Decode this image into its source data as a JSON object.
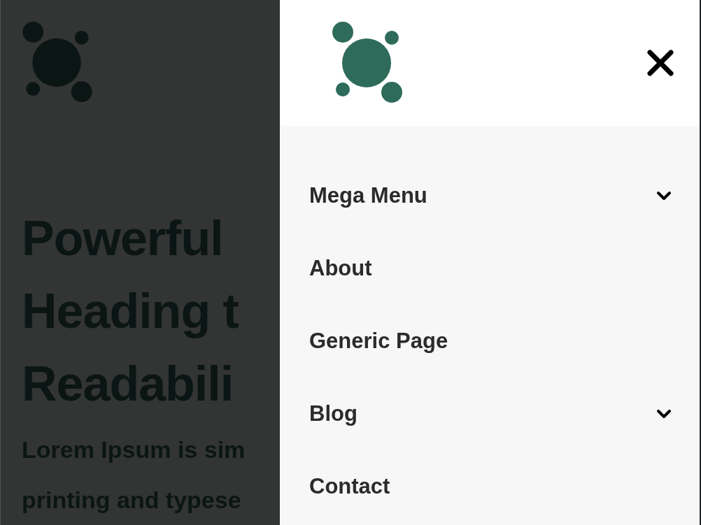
{
  "page": {
    "heading_lines": [
      "Powerful",
      "Heading t",
      "Readabili"
    ],
    "intro_lines": [
      "Lorem Ipsum is sim",
      "printing and typese"
    ]
  },
  "drawer": {
    "menu": [
      {
        "label": "Mega Menu",
        "has_submenu": true
      },
      {
        "label": "About",
        "has_submenu": false
      },
      {
        "label": "Generic Page",
        "has_submenu": false
      },
      {
        "label": "Blog",
        "has_submenu": true
      },
      {
        "label": "Contact",
        "has_submenu": false
      }
    ]
  }
}
